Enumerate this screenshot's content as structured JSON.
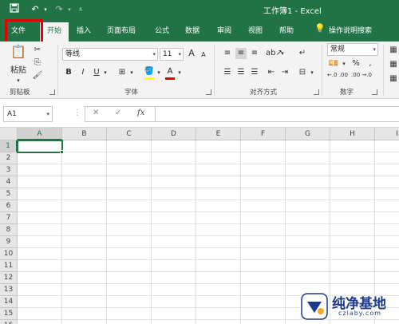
{
  "titlebar": {
    "title": "工作簿1  -  Excel",
    "save_icon": "save-icon",
    "undo_icon": "undo-icon",
    "redo_icon": "redo-icon",
    "customize_icon": "customize-quick-access-icon"
  },
  "tabs": {
    "file": "文件",
    "home": "开始",
    "insert": "插入",
    "page_layout": "页面布局",
    "formulas": "公式",
    "data": "数据",
    "review": "审阅",
    "view": "视图",
    "help": "帮助",
    "tell_me": "操作说明搜索"
  },
  "ribbon": {
    "paste_label": "粘贴",
    "clipboard_label": "剪贴板",
    "font_name": "等线",
    "font_size": "11",
    "font_label": "字体",
    "bold": "B",
    "italic": "I",
    "underline": "U",
    "alignment_label": "对齐方式",
    "number_format": "常规",
    "number_label": "数字",
    "percent": "%",
    "comma": ",",
    "increase_decimal": "←.0 .00",
    "decrease_decimal": ".00 →.0",
    "font_color_letter": "A",
    "grow_font": "A",
    "shrink_font": "A"
  },
  "formula_bar": {
    "name_box": "A1",
    "fx": "fx",
    "cancel": "✕",
    "confirm": "✓"
  },
  "grid": {
    "columns": [
      "A",
      "B",
      "C",
      "D",
      "E",
      "F",
      "G",
      "H",
      "I"
    ],
    "rows": [
      "1",
      "2",
      "3",
      "4",
      "5",
      "6",
      "7",
      "8",
      "9",
      "10",
      "11",
      "12",
      "13",
      "14",
      "15",
      "16"
    ]
  },
  "watermark": {
    "name": "纯净基地",
    "url": "czlaby.com"
  },
  "colors": {
    "accent": "#217346",
    "highlight": "#e30000"
  }
}
